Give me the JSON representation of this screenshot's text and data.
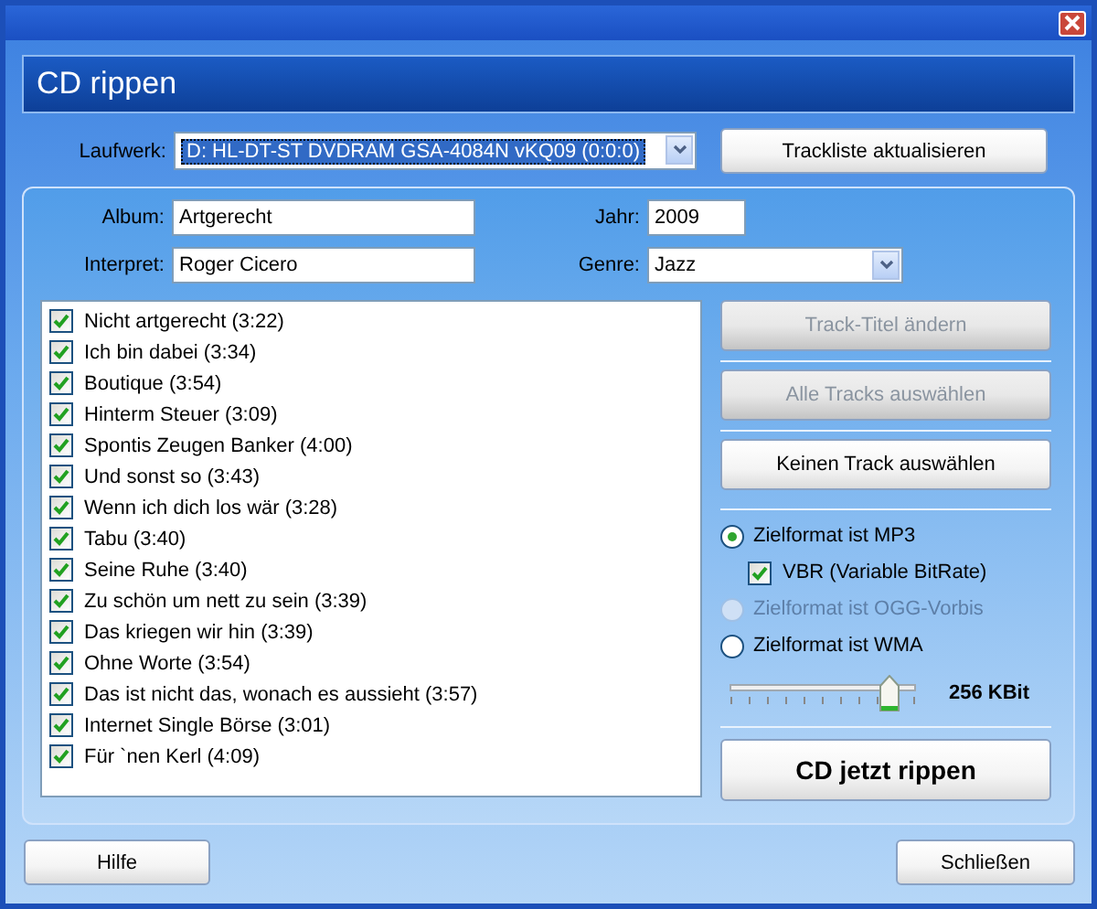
{
  "header": {
    "title": "CD rippen"
  },
  "drive": {
    "label": "Laufwerk:",
    "value": "D: HL-DT-ST DVDRAM GSA-4084N vKQ09 (0:0:0)",
    "button": "Trackliste aktualisieren"
  },
  "fields": [
    {
      "label": "Album:",
      "value": "Artgerecht",
      "kind": "text"
    },
    {
      "label": "Jahr:",
      "value": "2009",
      "kind": "text"
    },
    {
      "label": "Interpret:",
      "value": "Roger Cicero",
      "kind": "text"
    },
    {
      "label": "Genre:",
      "value": "Jazz",
      "kind": "select"
    }
  ],
  "tracks": [
    {
      "label": "Nicht artgerecht (3:22)",
      "checked": true
    },
    {
      "label": "Ich bin dabei (3:34)",
      "checked": true
    },
    {
      "label": "Boutique (3:54)",
      "checked": true
    },
    {
      "label": "Hinterm Steuer (3:09)",
      "checked": true
    },
    {
      "label": "Spontis Zeugen Banker (4:00)",
      "checked": true
    },
    {
      "label": "Und sonst so (3:43)",
      "checked": true
    },
    {
      "label": "Wenn ich dich los wär (3:28)",
      "checked": true
    },
    {
      "label": "Tabu (3:40)",
      "checked": true
    },
    {
      "label": "Seine Ruhe (3:40)",
      "checked": true
    },
    {
      "label": "Zu schön um nett zu sein (3:39)",
      "checked": true
    },
    {
      "label": "Das kriegen wir hin (3:39)",
      "checked": true
    },
    {
      "label": "Ohne Worte (3:54)",
      "checked": true
    },
    {
      "label": "Das ist nicht das, wonach es aussieht (3:57)",
      "checked": true
    },
    {
      "label": "Internet Single Börse (3:01)",
      "checked": true
    },
    {
      "label": "Für `nen Kerl (4:09)",
      "checked": true
    }
  ],
  "actions": [
    {
      "label": "Track-Titel ändern",
      "disabled": true
    },
    {
      "label": "Alle Tracks auswählen",
      "disabled": true
    },
    {
      "label": "Keinen Track auswählen",
      "disabled": false
    }
  ],
  "formats": [
    {
      "label": "Zielformat ist MP3",
      "selected": true,
      "disabled": false,
      "option": {
        "label": "VBR (Variable BitRate)",
        "checked": true
      }
    },
    {
      "label": "Zielformat ist OGG-Vorbis",
      "selected": false,
      "disabled": true
    },
    {
      "label": "Zielformat ist WMA",
      "selected": false,
      "disabled": false
    }
  ],
  "bitrate": {
    "level": 0.85,
    "reading": "256 KBit"
  },
  "rip_button": "CD jetzt rippen",
  "footer": {
    "help": "Hilfe",
    "close": "Schließen"
  }
}
